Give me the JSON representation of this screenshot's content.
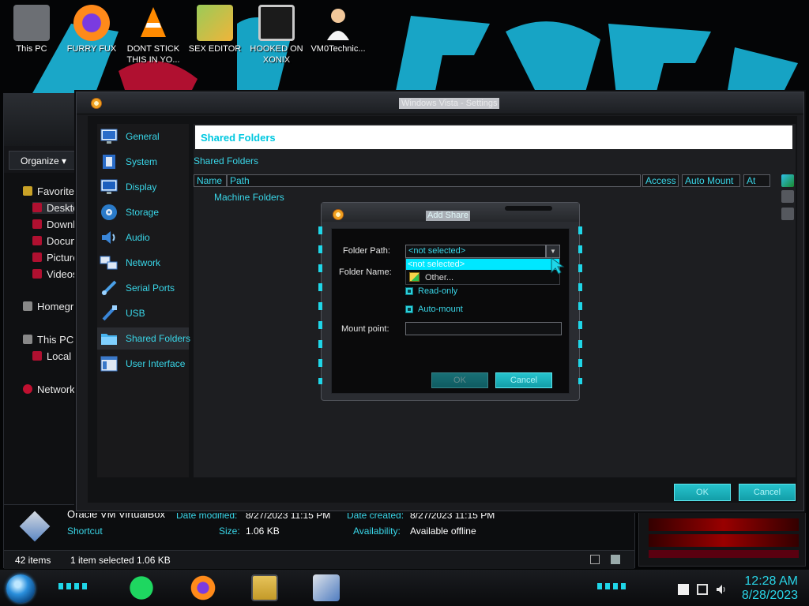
{
  "desktop": {
    "icons": [
      {
        "label": "This PC",
        "icon": "this-pc-icon"
      },
      {
        "label": "FURRY FUX",
        "icon": "firefox-icon"
      },
      {
        "label": "DONT STICK THIS IN YO...",
        "icon": "vlc-icon"
      },
      {
        "label": "SEX EDITOR",
        "icon": "hxd-icon"
      },
      {
        "label": "HOOKED ON XONIX",
        "icon": "xonix-icon"
      },
      {
        "label": "VM0Technic...",
        "icon": "doctor-icon"
      }
    ]
  },
  "explorer": {
    "organize_label": "Organize",
    "nav": {
      "favorites": "Favorite",
      "desktop": "Deskto",
      "downloads": "Downl",
      "documents": "Docun",
      "pictures": "Picture",
      "videos": "Videos",
      "homegroup": "Homegr",
      "this_pc": "This PC",
      "local": "Local",
      "network": "Network"
    },
    "details": {
      "name": "Oracle VM VirtualBox",
      "type": "Shortcut",
      "date_modified_label": "Date modified:",
      "date_modified": "8/27/2023 11:15 PM",
      "date_created_label": "Date created:",
      "date_created": "8/27/2023 11:15 PM",
      "size_label": "Size:",
      "size": "1.06 KB",
      "availability_label": "Availability:",
      "availability": "Available offline"
    },
    "status": {
      "count": "42 items",
      "selection": "1 item selected  1.06 KB"
    }
  },
  "settings": {
    "title": "Windows Vista - Settings",
    "sidebar": [
      {
        "label": "General",
        "icon": "monitor-icon"
      },
      {
        "label": "System",
        "icon": "chip-icon"
      },
      {
        "label": "Display",
        "icon": "display-icon"
      },
      {
        "label": "Storage",
        "icon": "disk-icon"
      },
      {
        "label": "Audio",
        "icon": "speaker-icon"
      },
      {
        "label": "Network",
        "icon": "network-icon"
      },
      {
        "label": "Serial Ports",
        "icon": "serial-port-icon"
      },
      {
        "label": "USB",
        "icon": "usb-icon"
      },
      {
        "label": "Shared Folders",
        "icon": "folder-icon"
      },
      {
        "label": "User Interface",
        "icon": "window-icon"
      }
    ],
    "active_index": 8,
    "header": "Shared Folders",
    "subtitle": "Shared Folders",
    "columns": [
      "Name",
      "Path",
      "Access",
      "Auto Mount",
      "At"
    ],
    "tree_row": "Machine Folders",
    "ok_label": "OK",
    "cancel_label": "Cancel"
  },
  "dialog": {
    "title": "Add Share",
    "folder_path_label": "Folder Path:",
    "folder_path_value": "<not selected>",
    "folder_name_label": "Folder Name:",
    "dropdown_options": [
      "<not selected>",
      "Other..."
    ],
    "readonly_label": "Read-only",
    "automount_label": "Auto-mount",
    "mount_point_label": "Mount point:",
    "ok_label": "OK",
    "cancel_label": "Cancel"
  },
  "taskbar": {
    "time": "12:28 AM",
    "date": "8/28/2023",
    "apps": [
      "spotify-icon",
      "firefox-icon",
      "file-explorer-icon",
      "virtualbox-icon"
    ]
  },
  "colors": {
    "accent": "#00c8e0",
    "accent_text": "#39d6e8",
    "selection": "#00e7ff"
  }
}
